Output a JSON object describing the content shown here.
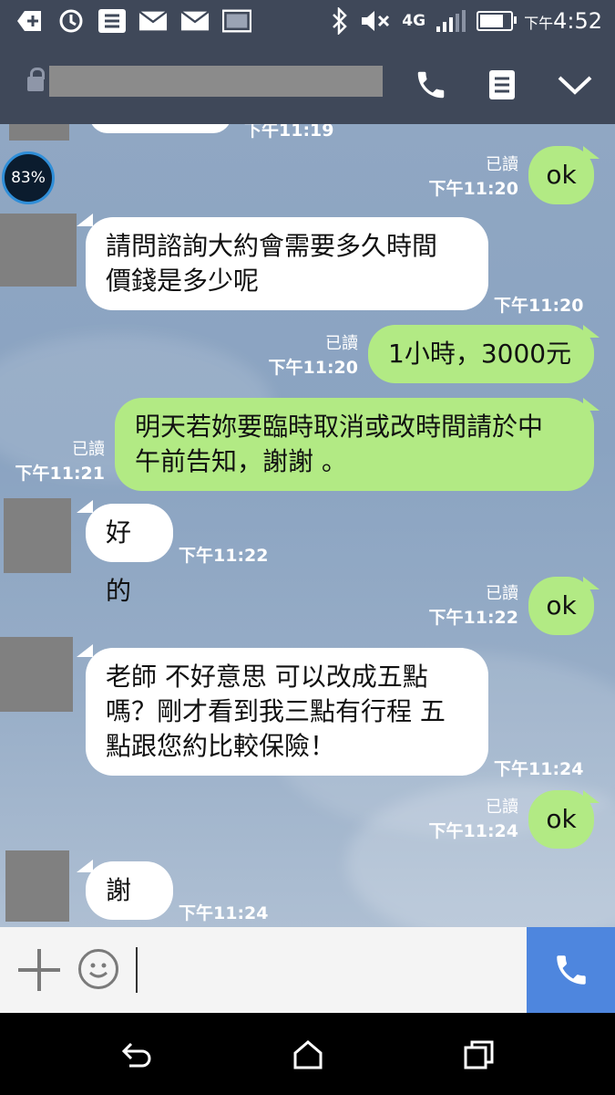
{
  "status_bar": {
    "time_prefix": "下午",
    "time": "4:52",
    "network": "4G",
    "battery_percent": 0.7
  },
  "header": {
    "title": ""
  },
  "battery_widget": {
    "percent": "83%"
  },
  "messages": [
    {
      "id": "m0",
      "dir": "in",
      "text": "",
      "time": "下午11:19",
      "partial": true
    },
    {
      "id": "m1",
      "dir": "out",
      "text": "ok",
      "read": "已讀",
      "time": "下午11:20"
    },
    {
      "id": "m2",
      "dir": "in",
      "lines": [
        "請問諮詢大約會需要多久時間",
        "價錢是多少呢"
      ],
      "time": "下午11:20"
    },
    {
      "id": "m3",
      "dir": "out",
      "text": "1小時，3000元",
      "read": "已讀",
      "time": "下午11:20"
    },
    {
      "id": "m4",
      "dir": "out",
      "lines": [
        "明天若妳要臨時取消或改時間請於中",
        "午前告知，謝謝 。"
      ],
      "read": "已讀",
      "time": "下午11:21"
    },
    {
      "id": "m5",
      "dir": "in",
      "text": "好的",
      "time": "下午11:22"
    },
    {
      "id": "m6",
      "dir": "out",
      "text": "ok",
      "read": "已讀",
      "time": "下午11:22"
    },
    {
      "id": "m7",
      "dir": "in",
      "lines": [
        "老師 不好意思 可以改成五點",
        "嗎？剛才看到我三點有行程 五",
        "點跟您約比較保險！"
      ],
      "time": "下午11:24"
    },
    {
      "id": "m8",
      "dir": "out",
      "text": "ok",
      "read": "已讀",
      "time": "下午11:24"
    },
    {
      "id": "m9",
      "dir": "in",
      "text": "謝謝",
      "time": "下午11:24"
    }
  ],
  "input": {
    "placeholder": "",
    "value": ""
  },
  "colors": {
    "header": "#3f4859",
    "incoming_bubble": "#ffffff",
    "outgoing_bubble": "#b2ea84",
    "send_button": "#4e86de"
  },
  "icons": [
    "add-icon",
    "sync-icon",
    "notes-icon",
    "mail-icon",
    "mail-icon",
    "image-icon",
    "bluetooth-icon",
    "mute-icon",
    "signal-icon",
    "battery-icon",
    "lock-icon",
    "phone-icon",
    "notes-icon",
    "chevron-down-icon",
    "plus-icon",
    "emoji-icon",
    "phone-icon",
    "back-icon",
    "home-icon",
    "recents-icon"
  ]
}
